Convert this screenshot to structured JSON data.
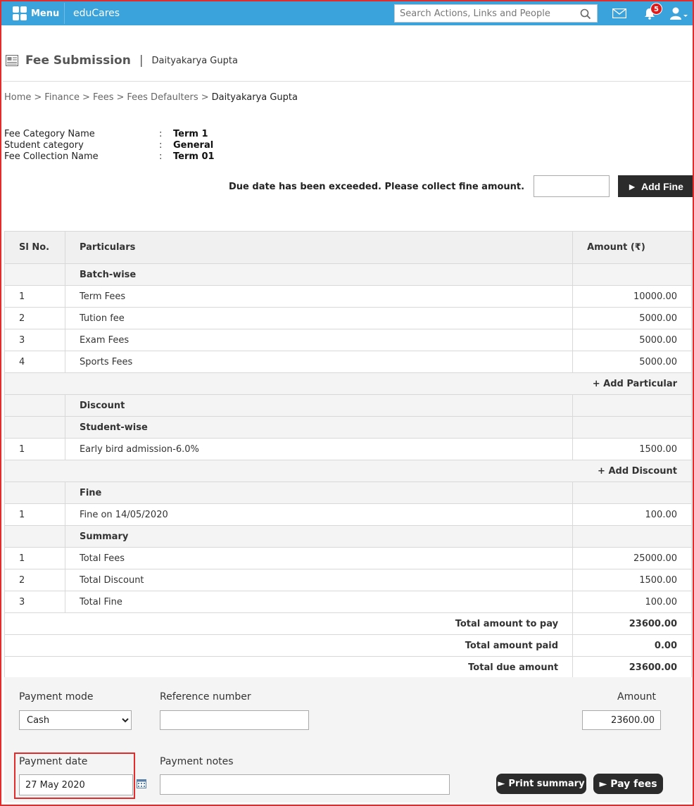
{
  "topbar": {
    "menu_label": "Menu",
    "brand": "eduCares",
    "search_placeholder": "Search Actions, Links and People",
    "notification_count": "5",
    "icons": [
      "apps-grid-icon",
      "search-icon",
      "mail-icon",
      "bell-icon",
      "user-icon"
    ]
  },
  "header": {
    "title": "Fee Submission",
    "separator": "|",
    "student_name": "Daityakarya Gupta"
  },
  "breadcrumb": [
    "Home",
    "Finance",
    "Fees",
    "Fees Defaulters",
    "Daityakarya Gupta"
  ],
  "breadcrumb_sep": ">",
  "info": [
    {
      "key": "Fee Category Name",
      "value": "Term 1"
    },
    {
      "key": "Student category",
      "value": "General"
    },
    {
      "key": "Fee Collection Name",
      "value": "Term 01"
    }
  ],
  "info_colon": ":",
  "fine_notice": {
    "text": "Due date has been exceeded. Please collect fine amount.",
    "input_value": "",
    "button_label": "Add Fine"
  },
  "table": {
    "headers": {
      "sl": "Sl No.",
      "particulars": "Particulars",
      "amount": "Amount (₹)"
    },
    "batch_section": "Batch-wise",
    "batch_rows": [
      {
        "sl": "1",
        "name": "Term Fees",
        "amount": "10000.00"
      },
      {
        "sl": "2",
        "name": "Tution fee",
        "amount": "5000.00"
      },
      {
        "sl": "3",
        "name": "Exam Fees",
        "amount": "5000.00"
      },
      {
        "sl": "4",
        "name": "Sports Fees",
        "amount": "5000.00"
      }
    ],
    "add_particular": "+ Add Particular",
    "discount_section": "Discount",
    "student_section": "Student-wise",
    "discount_rows": [
      {
        "sl": "1",
        "name": "Early bird admission-6.0%",
        "amount": "1500.00"
      }
    ],
    "add_discount": "+ Add Discount",
    "fine_section": "Fine",
    "fine_rows": [
      {
        "sl": "1",
        "name": "Fine on 14/05/2020",
        "amount": "100.00"
      }
    ],
    "remove_symbol": "×",
    "summary_section": "Summary",
    "summary_rows": [
      {
        "sl": "1",
        "name": "Total Fees",
        "amount": "25000.00"
      },
      {
        "sl": "2",
        "name": "Total Discount",
        "amount": "1500.00"
      },
      {
        "sl": "3",
        "name": "Total Fine",
        "amount": "100.00"
      }
    ],
    "totals": [
      {
        "label": "Total amount to pay",
        "value": "23600.00"
      },
      {
        "label": "Total amount paid",
        "value": "0.00"
      },
      {
        "label": "Total due amount",
        "value": "23600.00"
      }
    ]
  },
  "payment": {
    "mode_label": "Payment mode",
    "mode_value": "Cash",
    "reference_label": "Reference number",
    "reference_value": "",
    "amount_label": "Amount",
    "amount_value": "23600.00",
    "date_label": "Payment date",
    "date_value": "27 May 2020",
    "notes_label": "Payment notes",
    "notes_value": "",
    "print_button": "Print summary",
    "pay_button": "Pay fees"
  },
  "colors": {
    "topbar": "#3aa3dc",
    "highlight_border": "#e32b2b",
    "dark_button": "#2b2b2b",
    "badge": "#e01b1b"
  }
}
